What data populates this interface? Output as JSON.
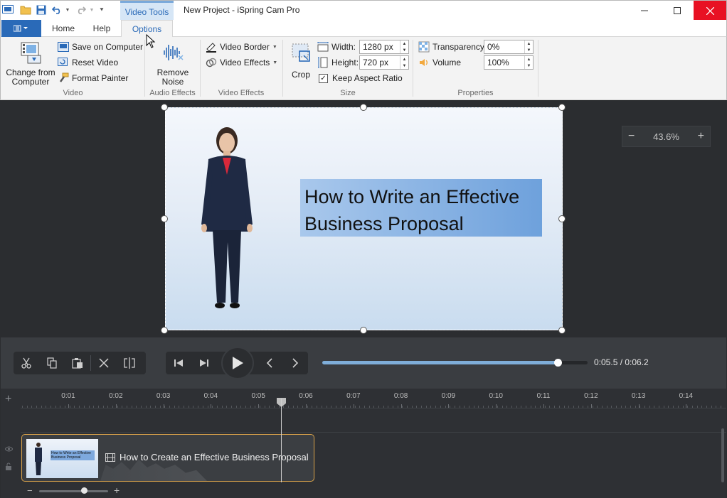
{
  "window": {
    "context_tab": "Video Tools",
    "title": "New Project - iSpring Cam Pro"
  },
  "ribbon_tabs": [
    "Home",
    "Help",
    "Options"
  ],
  "active_tab": "Options",
  "groups": {
    "video": {
      "label": "Video",
      "change_from_computer": "Change from Computer",
      "save_on_computer": "Save on Computer",
      "reset_video": "Reset Video",
      "format_painter": "Format Painter"
    },
    "audio_effects": {
      "label": "Audio Effects",
      "remove_noise": "Remove Noise"
    },
    "video_effects": {
      "label": "Video Effects",
      "video_border": "Video Border",
      "video_effects": "Video Effects"
    },
    "size": {
      "label": "Size",
      "crop": "Crop",
      "width_label": "Width:",
      "width_value": "1280 px",
      "height_label": "Height:",
      "height_value": "720 px",
      "keep_aspect": "Keep Aspect Ratio",
      "keep_aspect_checked": true
    },
    "properties": {
      "label": "Properties",
      "transparency_label": "Transparency:",
      "transparency_value": "0%",
      "volume_label": "Volume",
      "volume_value": "100%"
    }
  },
  "canvas": {
    "caption_line1": "How to Write an Effective",
    "caption_line2": "Business Proposal",
    "zoom_value": "43.6%",
    "zoom_minus": "−",
    "zoom_plus": "+"
  },
  "player": {
    "progress_fraction": 0.887,
    "time_readout": "0:05.5 / 0:06.2"
  },
  "timeline": {
    "ticks": [
      "0:01",
      "0:02",
      "0:03",
      "0:04",
      "0:05",
      "0:06",
      "0:07",
      "0:08",
      "0:09",
      "0:10",
      "0:11",
      "0:12",
      "0:13",
      "0:14"
    ],
    "clip_title": "How to Create an Effective Business Proposal",
    "thumb_caption": "How to Write an Effective Business Proposal",
    "zoom_minus": "−",
    "zoom_plus": "+",
    "add_track": "+"
  },
  "colors": {
    "accent": "#2a6ab8",
    "close_button": "#e81123",
    "progress_fill": "#7faed9",
    "clip_border": "#d9a24a"
  }
}
